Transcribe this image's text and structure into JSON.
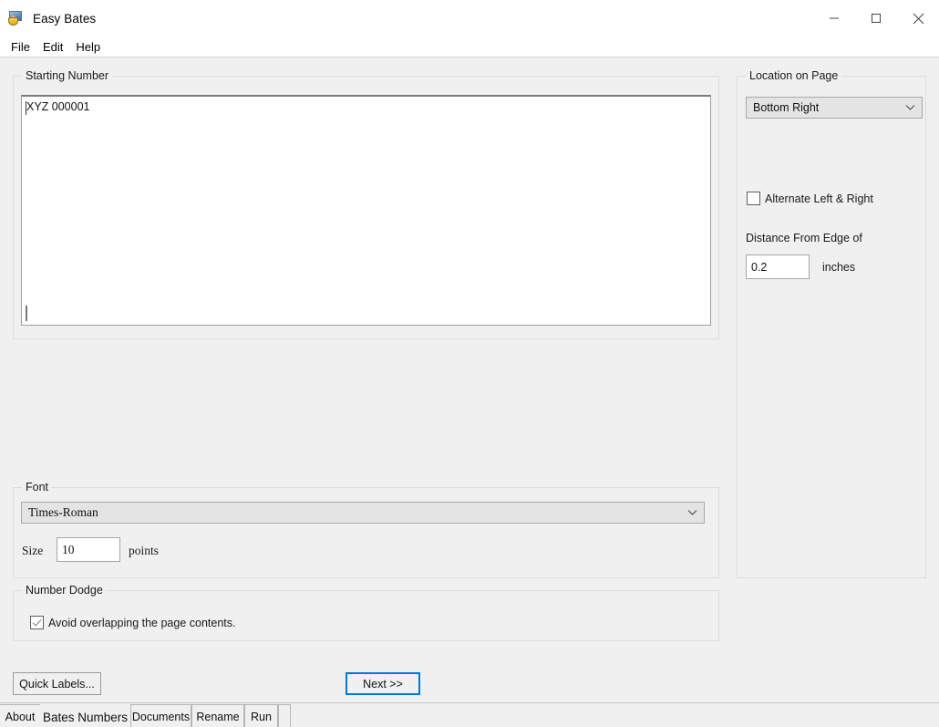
{
  "window": {
    "title": "Easy Bates",
    "icon": "app-stamp-icon",
    "minimize": "minimize-icon",
    "maximize": "maximize-icon",
    "close": "close-icon"
  },
  "menu": {
    "items": [
      {
        "label": "File"
      },
      {
        "label": "Edit"
      },
      {
        "label": "Help"
      }
    ]
  },
  "starting_number": {
    "group_label": "Starting Number",
    "value": "XYZ 000001"
  },
  "location_on_page": {
    "group_label": "Location on Page",
    "position_select": {
      "value": "Bottom Right",
      "chevron": "chevron-down-icon"
    },
    "alternate_checkbox": {
      "label": "Alternate Left & Right",
      "checked": false
    },
    "distance_label": "Distance From Edge of",
    "distance_value": "0.2",
    "distance_units": "inches"
  },
  "font": {
    "group_label": "Font",
    "family_select": {
      "value": "Times-Roman",
      "chevron": "chevron-down-icon"
    },
    "size_label": "Size",
    "size_value": "10",
    "size_units": "points"
  },
  "number_dodge": {
    "group_label": "Number Dodge",
    "avoid_checkbox": {
      "label": "Avoid overlapping the page contents.",
      "checked": true
    }
  },
  "actions": {
    "quick_labels": "Quick Labels...",
    "next": "Next >>"
  },
  "tabs": {
    "items": [
      {
        "label": "About",
        "active": false
      },
      {
        "label": "Bates Numbers",
        "active": true
      },
      {
        "label": "Documents",
        "active": false
      },
      {
        "label": "Rename",
        "active": false
      },
      {
        "label": "Run",
        "active": false
      }
    ]
  },
  "colors": {
    "window_bg": "#f0f0f0",
    "titlebar_bg": "#ffffff",
    "field_bg": "#ffffff",
    "combo_bg": "#e4e4e4",
    "focus_ring": "#0078d7",
    "group_border": "#dcdcdc"
  }
}
